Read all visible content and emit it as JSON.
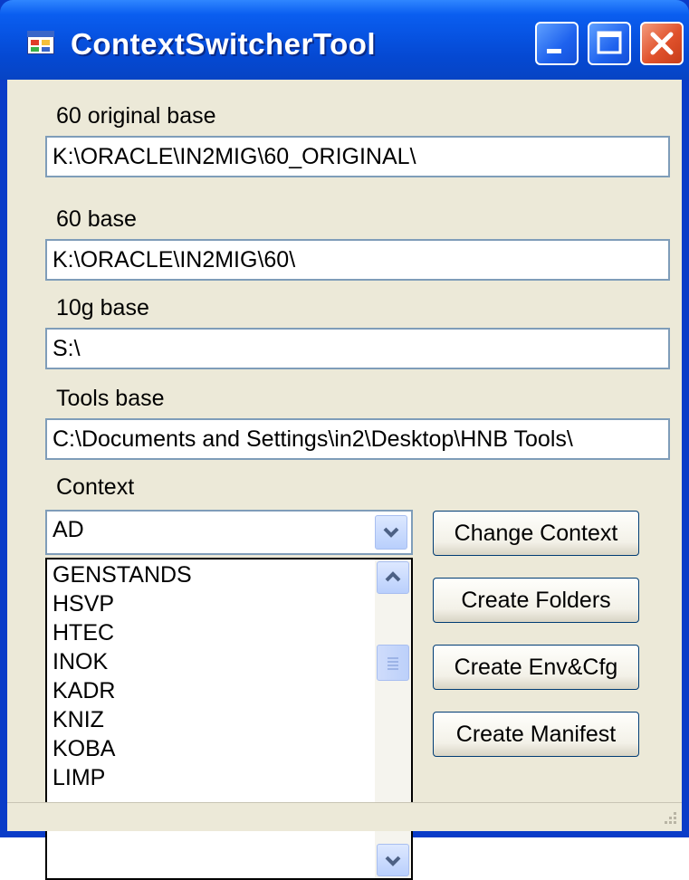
{
  "window": {
    "title": "ContextSwitcherTool"
  },
  "fields": {
    "original_base": {
      "label": "60 original base",
      "value": "K:\\ORACLE\\IN2MIG\\60_ORIGINAL\\"
    },
    "base_60": {
      "label": "60 base",
      "value": "K:\\ORACLE\\IN2MIG\\60\\"
    },
    "base_10g": {
      "label": "10g base",
      "value": "S:\\"
    },
    "tools_base": {
      "label": "Tools base",
      "value": "C:\\Documents and Settings\\in2\\Desktop\\HNB Tools\\"
    }
  },
  "context": {
    "label": "Context",
    "selected": "AD",
    "options": [
      "GENSTANDS",
      "HSVP",
      "HTEC",
      "INOK",
      "KADR",
      "KNIZ",
      "KOBA",
      "LIMP"
    ]
  },
  "buttons": {
    "change_context": "Change Context",
    "create_folders": "Create Folders",
    "create_env_cfg": "Create Env&Cfg",
    "create_manifest": "Create Manifest"
  },
  "colors": {
    "titlebar": "#0753e2",
    "client": "#ece9d8",
    "textbox_border": "#7f9db9"
  }
}
